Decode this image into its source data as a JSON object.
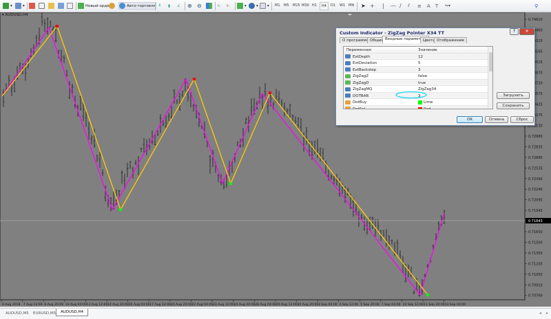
{
  "toolbar": {
    "new_order": "Новый ордер",
    "autotrading": "Авто-торговля",
    "timeframes": [
      "M1",
      "M5",
      "M15",
      "M30",
      "H1",
      "H4",
      "D1",
      "W1",
      "MN"
    ],
    "active_timeframe": "H4",
    "icons": [
      "new-chart-icon",
      "profiles-icon",
      "market-watch-icon",
      "navigator-icon",
      "data-window-icon",
      "terminal-icon",
      "tester-icon",
      "new-order-icon",
      "metaeditor-icon",
      "autotrading-icon",
      "bar-chart-icon",
      "candles-icon",
      "line-chart-icon",
      "zoom-in-icon",
      "zoom-out-icon",
      "tile-icon",
      "autoscroll-icon",
      "chart-shift-icon",
      "indicators-icon",
      "periods-icon",
      "templates-icon",
      "cursor-icon",
      "crosshair-icon",
      "vertical-line-icon",
      "horizontal-line-icon",
      "trendline-icon",
      "channel-icon",
      "fibonacci-icon",
      "text-icon",
      "label-icon",
      "arrows-icon",
      "search-icon"
    ]
  },
  "chart": {
    "symbol": "AUDUSD,H4",
    "current_price": "0.71843",
    "price_labels": [
      "0.74610",
      "0.74460",
      "0.74315",
      "0.74165",
      "0.74015",
      "0.73870",
      "0.73720",
      "0.73575",
      "0.73425",
      "0.73275",
      "0.73130",
      "0.72980",
      "0.72835",
      "0.72685",
      "0.72535",
      "0.72390",
      "0.72240",
      "0.72095",
      "0.71945",
      "0.71795",
      "0.71650",
      "0.71500",
      "0.71355",
      "0.71205",
      "0.71055",
      "0.70910",
      "0.70760"
    ],
    "time_labels": [
      "6 Aug 2018",
      "7 Aug 12:00",
      "8 Aug 20:00",
      "10 Aug 04:00",
      "13 Aug 12:00",
      "14 Aug 20:00",
      "16 Aug 04:00",
      "17 Aug 12:00",
      "20 Aug 20:00",
      "22 Aug 04:00",
      "23 Aug 12:00",
      "24 Aug 20:00",
      "28 Aug 04:00",
      "29 Aug 12:00",
      "30 Aug 20:00",
      "3 Sep 04:00",
      "4 Sep 12:00",
      "5 Sep 20:00",
      "7 Sep 04:00",
      "10 Sep 12:00",
      "11 Sep 20:00",
      "13 Sep 04:00"
    ],
    "colors": {
      "background": "#808080",
      "bars": "#333333",
      "zigzag": "#ff00ff",
      "zigzag_lagged": "#ffcc00",
      "dot_buy": "#00ff00",
      "dot_sell": "#ff0000",
      "annotation": "#00e5ff"
    }
  },
  "dialog": {
    "title": "Custom Indicator - ZigZag Pointer X34 TT",
    "tabs": [
      "О программе",
      "Общие",
      "Входные параметры",
      "Цвета",
      "Отображение"
    ],
    "active_tab": "Входные параметры",
    "columns": [
      "Переменная",
      "Значение"
    ],
    "rows": [
      {
        "name": "ExtDepth",
        "value": "12",
        "type": "int"
      },
      {
        "name": "ExtDeviation",
        "value": "5",
        "type": "int"
      },
      {
        "name": "ExtBackstep",
        "value": "3",
        "type": "int"
      },
      {
        "name": "ZigZagZ",
        "value": "false",
        "type": "bool"
      },
      {
        "name": "ZigZagD",
        "value": "true",
        "type": "bool"
      },
      {
        "name": "ZigZagMQ",
        "value": "ZigZag34",
        "type": "string"
      },
      {
        "name": "DOTBAR",
        "value": "3",
        "type": "int"
      },
      {
        "name": "DotBuy",
        "value": "Lime",
        "type": "color",
        "color": "#00ff00"
      },
      {
        "name": "DotSel",
        "value": "Red",
        "type": "color",
        "color": "#ff0000"
      }
    ],
    "load_button": "Загрузить",
    "save_button": "Сохранить",
    "ok_button": "OK",
    "cancel_button": "Отмена",
    "reset_button": "Сброс"
  },
  "chart_tabs": [
    "AUDUSD,M5",
    "EURUSD,M5",
    "AUDUSD,H4"
  ],
  "active_chart_tab": "AUDUSD,H4"
}
